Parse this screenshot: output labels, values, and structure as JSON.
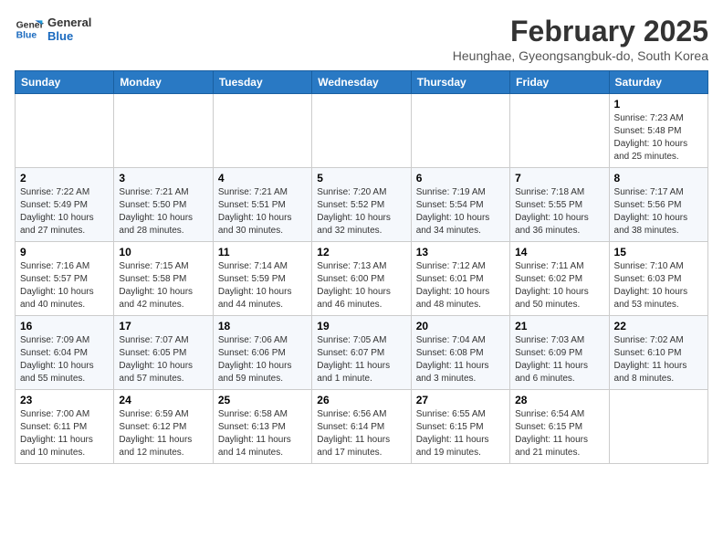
{
  "header": {
    "logo_line1": "General",
    "logo_line2": "Blue",
    "month": "February 2025",
    "location": "Heunghae, Gyeongsangbuk-do, South Korea"
  },
  "days_of_week": [
    "Sunday",
    "Monday",
    "Tuesday",
    "Wednesday",
    "Thursday",
    "Friday",
    "Saturday"
  ],
  "weeks": [
    [
      {
        "day": "",
        "info": ""
      },
      {
        "day": "",
        "info": ""
      },
      {
        "day": "",
        "info": ""
      },
      {
        "day": "",
        "info": ""
      },
      {
        "day": "",
        "info": ""
      },
      {
        "day": "",
        "info": ""
      },
      {
        "day": "1",
        "info": "Sunrise: 7:23 AM\nSunset: 5:48 PM\nDaylight: 10 hours and 25 minutes."
      }
    ],
    [
      {
        "day": "2",
        "info": "Sunrise: 7:22 AM\nSunset: 5:49 PM\nDaylight: 10 hours and 27 minutes."
      },
      {
        "day": "3",
        "info": "Sunrise: 7:21 AM\nSunset: 5:50 PM\nDaylight: 10 hours and 28 minutes."
      },
      {
        "day": "4",
        "info": "Sunrise: 7:21 AM\nSunset: 5:51 PM\nDaylight: 10 hours and 30 minutes."
      },
      {
        "day": "5",
        "info": "Sunrise: 7:20 AM\nSunset: 5:52 PM\nDaylight: 10 hours and 32 minutes."
      },
      {
        "day": "6",
        "info": "Sunrise: 7:19 AM\nSunset: 5:54 PM\nDaylight: 10 hours and 34 minutes."
      },
      {
        "day": "7",
        "info": "Sunrise: 7:18 AM\nSunset: 5:55 PM\nDaylight: 10 hours and 36 minutes."
      },
      {
        "day": "8",
        "info": "Sunrise: 7:17 AM\nSunset: 5:56 PM\nDaylight: 10 hours and 38 minutes."
      }
    ],
    [
      {
        "day": "9",
        "info": "Sunrise: 7:16 AM\nSunset: 5:57 PM\nDaylight: 10 hours and 40 minutes."
      },
      {
        "day": "10",
        "info": "Sunrise: 7:15 AM\nSunset: 5:58 PM\nDaylight: 10 hours and 42 minutes."
      },
      {
        "day": "11",
        "info": "Sunrise: 7:14 AM\nSunset: 5:59 PM\nDaylight: 10 hours and 44 minutes."
      },
      {
        "day": "12",
        "info": "Sunrise: 7:13 AM\nSunset: 6:00 PM\nDaylight: 10 hours and 46 minutes."
      },
      {
        "day": "13",
        "info": "Sunrise: 7:12 AM\nSunset: 6:01 PM\nDaylight: 10 hours and 48 minutes."
      },
      {
        "day": "14",
        "info": "Sunrise: 7:11 AM\nSunset: 6:02 PM\nDaylight: 10 hours and 50 minutes."
      },
      {
        "day": "15",
        "info": "Sunrise: 7:10 AM\nSunset: 6:03 PM\nDaylight: 10 hours and 53 minutes."
      }
    ],
    [
      {
        "day": "16",
        "info": "Sunrise: 7:09 AM\nSunset: 6:04 PM\nDaylight: 10 hours and 55 minutes."
      },
      {
        "day": "17",
        "info": "Sunrise: 7:07 AM\nSunset: 6:05 PM\nDaylight: 10 hours and 57 minutes."
      },
      {
        "day": "18",
        "info": "Sunrise: 7:06 AM\nSunset: 6:06 PM\nDaylight: 10 hours and 59 minutes."
      },
      {
        "day": "19",
        "info": "Sunrise: 7:05 AM\nSunset: 6:07 PM\nDaylight: 11 hours and 1 minute."
      },
      {
        "day": "20",
        "info": "Sunrise: 7:04 AM\nSunset: 6:08 PM\nDaylight: 11 hours and 3 minutes."
      },
      {
        "day": "21",
        "info": "Sunrise: 7:03 AM\nSunset: 6:09 PM\nDaylight: 11 hours and 6 minutes."
      },
      {
        "day": "22",
        "info": "Sunrise: 7:02 AM\nSunset: 6:10 PM\nDaylight: 11 hours and 8 minutes."
      }
    ],
    [
      {
        "day": "23",
        "info": "Sunrise: 7:00 AM\nSunset: 6:11 PM\nDaylight: 11 hours and 10 minutes."
      },
      {
        "day": "24",
        "info": "Sunrise: 6:59 AM\nSunset: 6:12 PM\nDaylight: 11 hours and 12 minutes."
      },
      {
        "day": "25",
        "info": "Sunrise: 6:58 AM\nSunset: 6:13 PM\nDaylight: 11 hours and 14 minutes."
      },
      {
        "day": "26",
        "info": "Sunrise: 6:56 AM\nSunset: 6:14 PM\nDaylight: 11 hours and 17 minutes."
      },
      {
        "day": "27",
        "info": "Sunrise: 6:55 AM\nSunset: 6:15 PM\nDaylight: 11 hours and 19 minutes."
      },
      {
        "day": "28",
        "info": "Sunrise: 6:54 AM\nSunset: 6:15 PM\nDaylight: 11 hours and 21 minutes."
      },
      {
        "day": "",
        "info": ""
      }
    ]
  ]
}
